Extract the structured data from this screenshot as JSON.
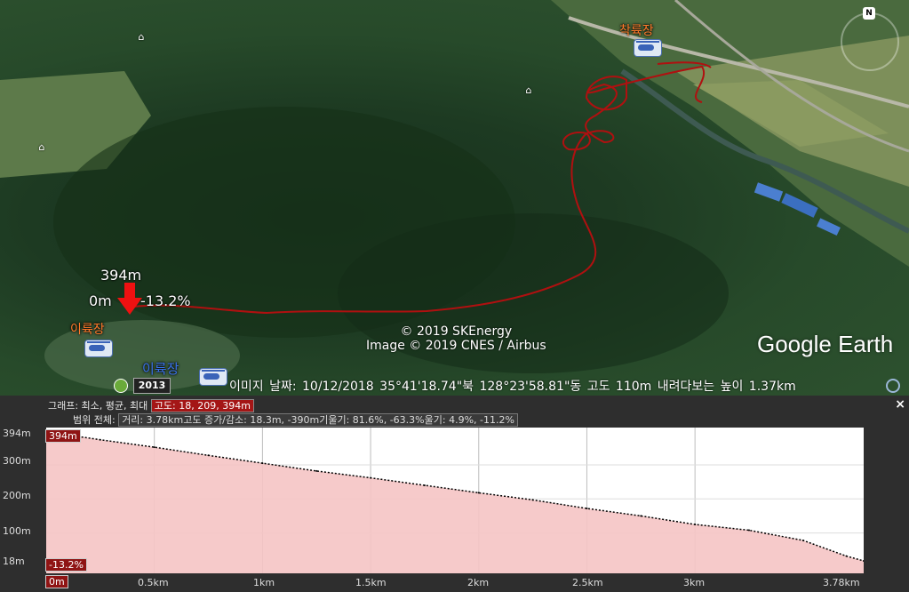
{
  "map": {
    "labels": {
      "landing_top": "착륙장",
      "takeoff_left": "이륙장",
      "takeoff_bottom": "이륙장"
    },
    "path_markers": {
      "max_label": "394m",
      "min_label": "0m",
      "slope_label": "-13.2%"
    },
    "compass_letter": "N",
    "copyright": {
      "line1": "© 2019 SKEnergy",
      "line2": "Image © 2019 CNES / Airbus"
    },
    "logo": "Google Earth",
    "status": {
      "year": "2013",
      "text": "이미지 날짜: 10/12/2018    35°41'18.74\"북  128°23'58.81\"동  고도  110m    내려다보는 높이   1.37km"
    },
    "track_color": "#b01010"
  },
  "profile": {
    "close_label": "×",
    "graph_prefix": "그래프: 최소, 평균, 최대",
    "graph_values": "고도: 18, 209, 394m",
    "range_prefix": "범위 전체:",
    "range_values": "거리: 3.78km고도 증가/감소: 18.3m, -390m기울기: 81.6%, -63.3%울기: 4.9%, -11.2%",
    "max_tag": "394m",
    "min_tag": "-13.2%",
    "start_tag": "0m"
  },
  "chart_data": {
    "type": "area",
    "xlabel": "",
    "ylabel": "",
    "x_ticks": [
      "0m",
      "0.5km",
      "1km",
      "1.5km",
      "2km",
      "2.5km",
      "3km",
      "3.78km"
    ],
    "y_ticks": [
      "394m",
      "300m",
      "200m",
      "100m",
      "18m"
    ],
    "x_km": [
      0,
      0.1,
      0.25,
      0.5,
      0.75,
      1.0,
      1.25,
      1.5,
      1.75,
      2.0,
      2.25,
      2.5,
      2.75,
      3.0,
      3.25,
      3.5,
      3.7,
      3.78
    ],
    "y_m": [
      394,
      388,
      374,
      352,
      328,
      305,
      282,
      262,
      240,
      218,
      197,
      172,
      150,
      125,
      108,
      78,
      32,
      18
    ],
    "xlim": [
      0,
      3.78
    ],
    "ylim": [
      18,
      394
    ],
    "fill_color": "#f5c4c4",
    "line_color": "#000000"
  }
}
